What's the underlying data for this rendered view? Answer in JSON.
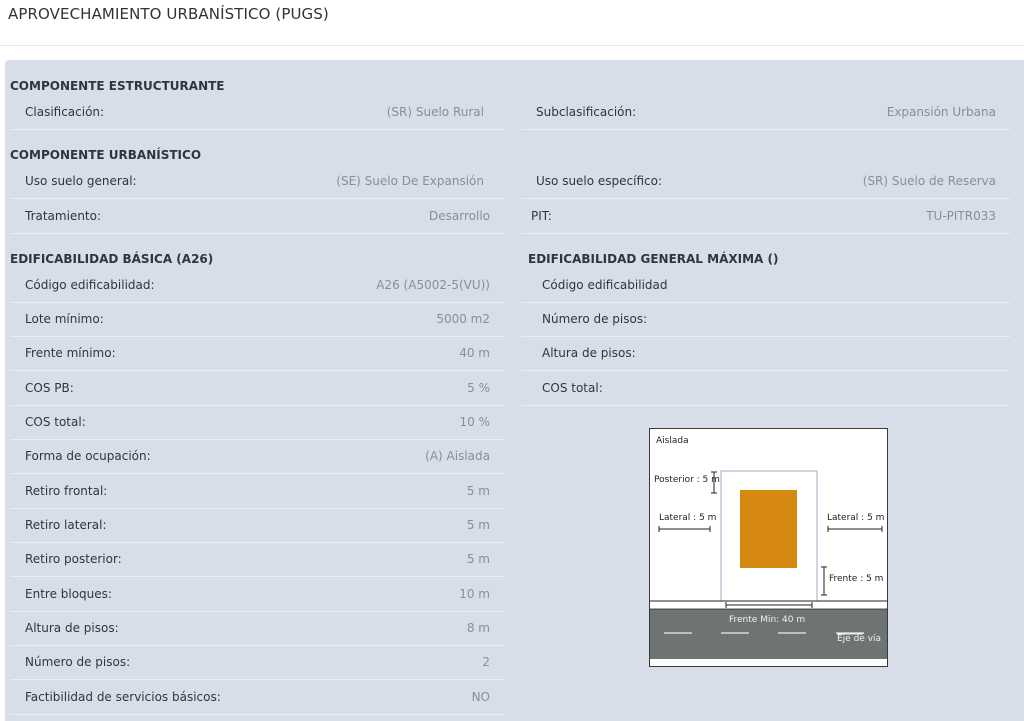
{
  "header": {
    "title": "APROVECHAMIENTO URBANÍSTICO (PUGS)"
  },
  "estructurante": {
    "title": "COMPONENTE ESTRUCTURANTE",
    "rows": [
      {
        "label": "Clasificación:",
        "value": "(SR) Suelo Rural"
      },
      {
        "label": "Subclasificación:",
        "value": "Expansión Urbana"
      }
    ]
  },
  "urbanistico": {
    "title": "COMPONENTE URBANÍSTICO",
    "rows": [
      {
        "label": "Uso suelo general:",
        "value": "(SE) Suelo De Expansión"
      },
      {
        "label": "Uso suelo específico:",
        "value": "(SR) Suelo de Reserva"
      },
      {
        "label": "Tratamiento:",
        "value": "Desarrollo"
      },
      {
        "label": "PIT:",
        "value": "TU-PITR033"
      }
    ]
  },
  "basica": {
    "title": "EDIFICABILIDAD BÁSICA (A26)",
    "rows": [
      {
        "label": "Código edificabilidad:",
        "value": "A26 (A5002-5(VU))"
      },
      {
        "label": "Lote mínimo:",
        "value": "5000 m2"
      },
      {
        "label": "Frente mínimo:",
        "value": "40 m"
      },
      {
        "label": "COS PB:",
        "value": "5 %"
      },
      {
        "label": "COS total:",
        "value": "10 %"
      },
      {
        "label": "Forma de ocupación:",
        "value": "(A) Aislada"
      },
      {
        "label": "Retiro frontal:",
        "value": "5 m"
      },
      {
        "label": "Retiro lateral:",
        "value": "5 m"
      },
      {
        "label": "Retiro posterior:",
        "value": "5 m"
      },
      {
        "label": "Entre bloques:",
        "value": "10 m"
      },
      {
        "label": "Altura de pisos:",
        "value": "8 m"
      },
      {
        "label": "Número de pisos:",
        "value": "2"
      },
      {
        "label": "Factibilidad de servicios básicos:",
        "value": "NO"
      }
    ]
  },
  "maxima": {
    "title": "EDIFICABILIDAD GENERAL MÁXIMA ()",
    "rows": [
      {
        "label": "Código edificabilidad"
      },
      {
        "label": "Número de pisos:"
      },
      {
        "label": "Altura de pisos:"
      },
      {
        "label": "COS total:"
      }
    ]
  },
  "diagram": {
    "title": "Aislada",
    "posterior": "Posterior : 5 m",
    "lateral_left": "Lateral : 5 m",
    "lateral_right": "Lateral : 5 m",
    "frente": "Frente : 5 m",
    "frente_min": "Frente Min: 40 m",
    "eje": "Eje de vía",
    "colors": {
      "building": "#d68910",
      "road": "#6e7471",
      "lot_border": "#9fb2c5"
    }
  }
}
